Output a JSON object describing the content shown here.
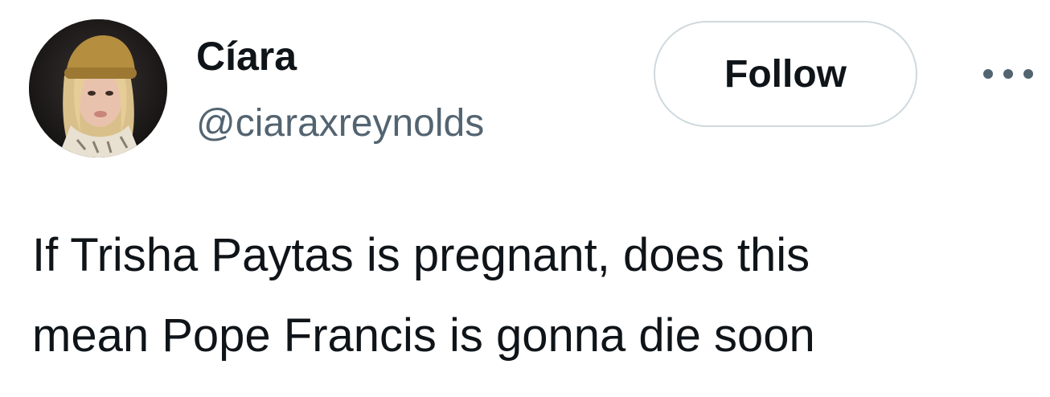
{
  "user": {
    "display_name": "Cíara",
    "handle": "@ciaraxreynolds",
    "avatar_icon": "profile-photo"
  },
  "actions": {
    "follow_label": "Follow",
    "more_icon": "more-horizontal-icon"
  },
  "tweet": {
    "lines": [
      "If Trisha Paytas is pregnant, does this",
      "mean Pope Francis is gonna die soon"
    ]
  },
  "colors": {
    "text_primary": "#0f1419",
    "text_secondary": "#536471",
    "button_border": "#cfd9de"
  }
}
